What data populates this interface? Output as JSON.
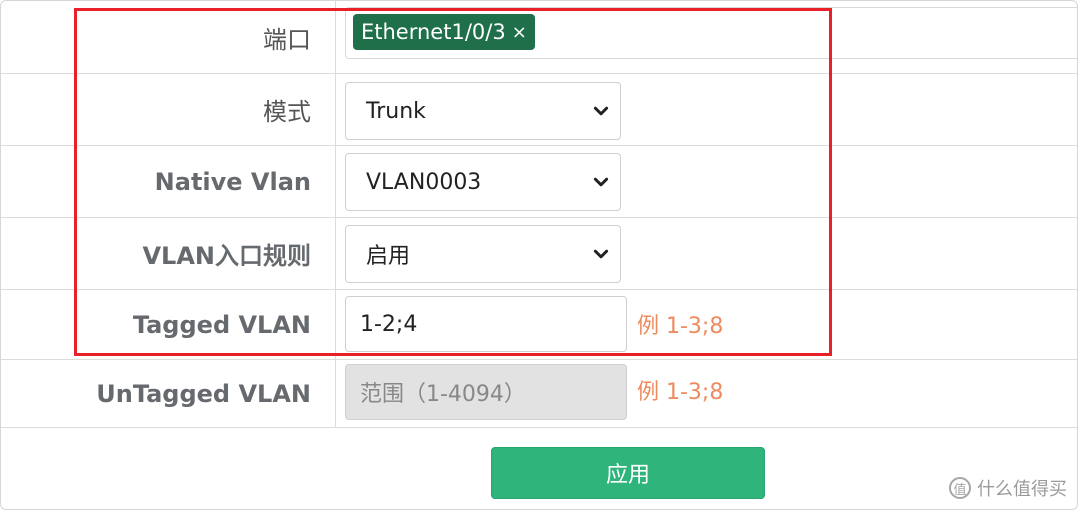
{
  "form": {
    "port": {
      "label": "端口",
      "tag": "Ethernet1/0/3",
      "tag_remove": "×"
    },
    "mode": {
      "label": "模式",
      "value": "Trunk"
    },
    "native_vlan": {
      "label": "Native Vlan",
      "value": "VLAN0003"
    },
    "ingress_rule": {
      "label": "VLAN入口规则",
      "value": "启用"
    },
    "tagged_vlan": {
      "label": "Tagged VLAN",
      "value": "1-2;4",
      "hint": "例 1-3;8"
    },
    "untagged_vlan": {
      "label": "UnTagged VLAN",
      "placeholder": "范围（1-4094）",
      "hint": "例 1-3;8"
    }
  },
  "apply_label": "应用",
  "watermark": {
    "logo": "值",
    "text": "什么值得买"
  },
  "colors": {
    "tag_bg": "#1e6f4a",
    "highlight_border": "#e8202a",
    "apply_bg": "#2fb47c",
    "hint": "#ee8b5e"
  }
}
